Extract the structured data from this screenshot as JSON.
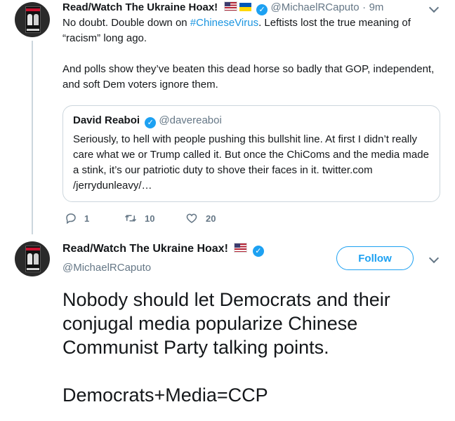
{
  "first_tweet": {
    "display_name": "Read/Watch The Ukraine Hoax!",
    "handle": "@MichaelRCaputo",
    "separator": "·",
    "time": "9m",
    "text_parts": {
      "line1_before": "No doubt. Double down on ",
      "hashtag": "#ChineseVirus",
      "line1_after": ". Leftists lost the true meaning of “racism” long ago.",
      "paragraph2": "And polls show they’ve beaten this dead horse so badly that GOP, independent, and soft Dem voters ignore them."
    },
    "quoted_tweet": {
      "display_name": "David Reaboi",
      "handle": "@davereaboi",
      "text": "Seriously, to hell with people pushing this bullshit line. At first I didn’t really care what we or Trump called it. But once the ChiComs and the media made a stink, it’s our patriotic duty to shove their faces in it. twitter.com /jerrydunleavy/…"
    },
    "actions": {
      "reply_count": "1",
      "retweet_count": "10",
      "like_count": "20"
    }
  },
  "second_tweet": {
    "display_name": "Read/Watch The Ukraine Hoax!",
    "handle": "@MichaelRCaputo",
    "follow_label": "Follow",
    "text_lines": [
      "Nobody should let Democrats and their conjugal media popularize Chinese Communist Party talking points.",
      "Democrats+Media=CCP"
    ]
  },
  "icons": [
    "verified-badge-icon",
    "us-flag-icon",
    "ukraine-flag-icon",
    "reply-icon",
    "retweet-icon",
    "like-icon",
    "chevron-down-icon"
  ],
  "colors": {
    "accent": "#1da1f2",
    "link": "#1b95e0",
    "secondary_text": "#657786",
    "border": "#ccd6dd"
  }
}
